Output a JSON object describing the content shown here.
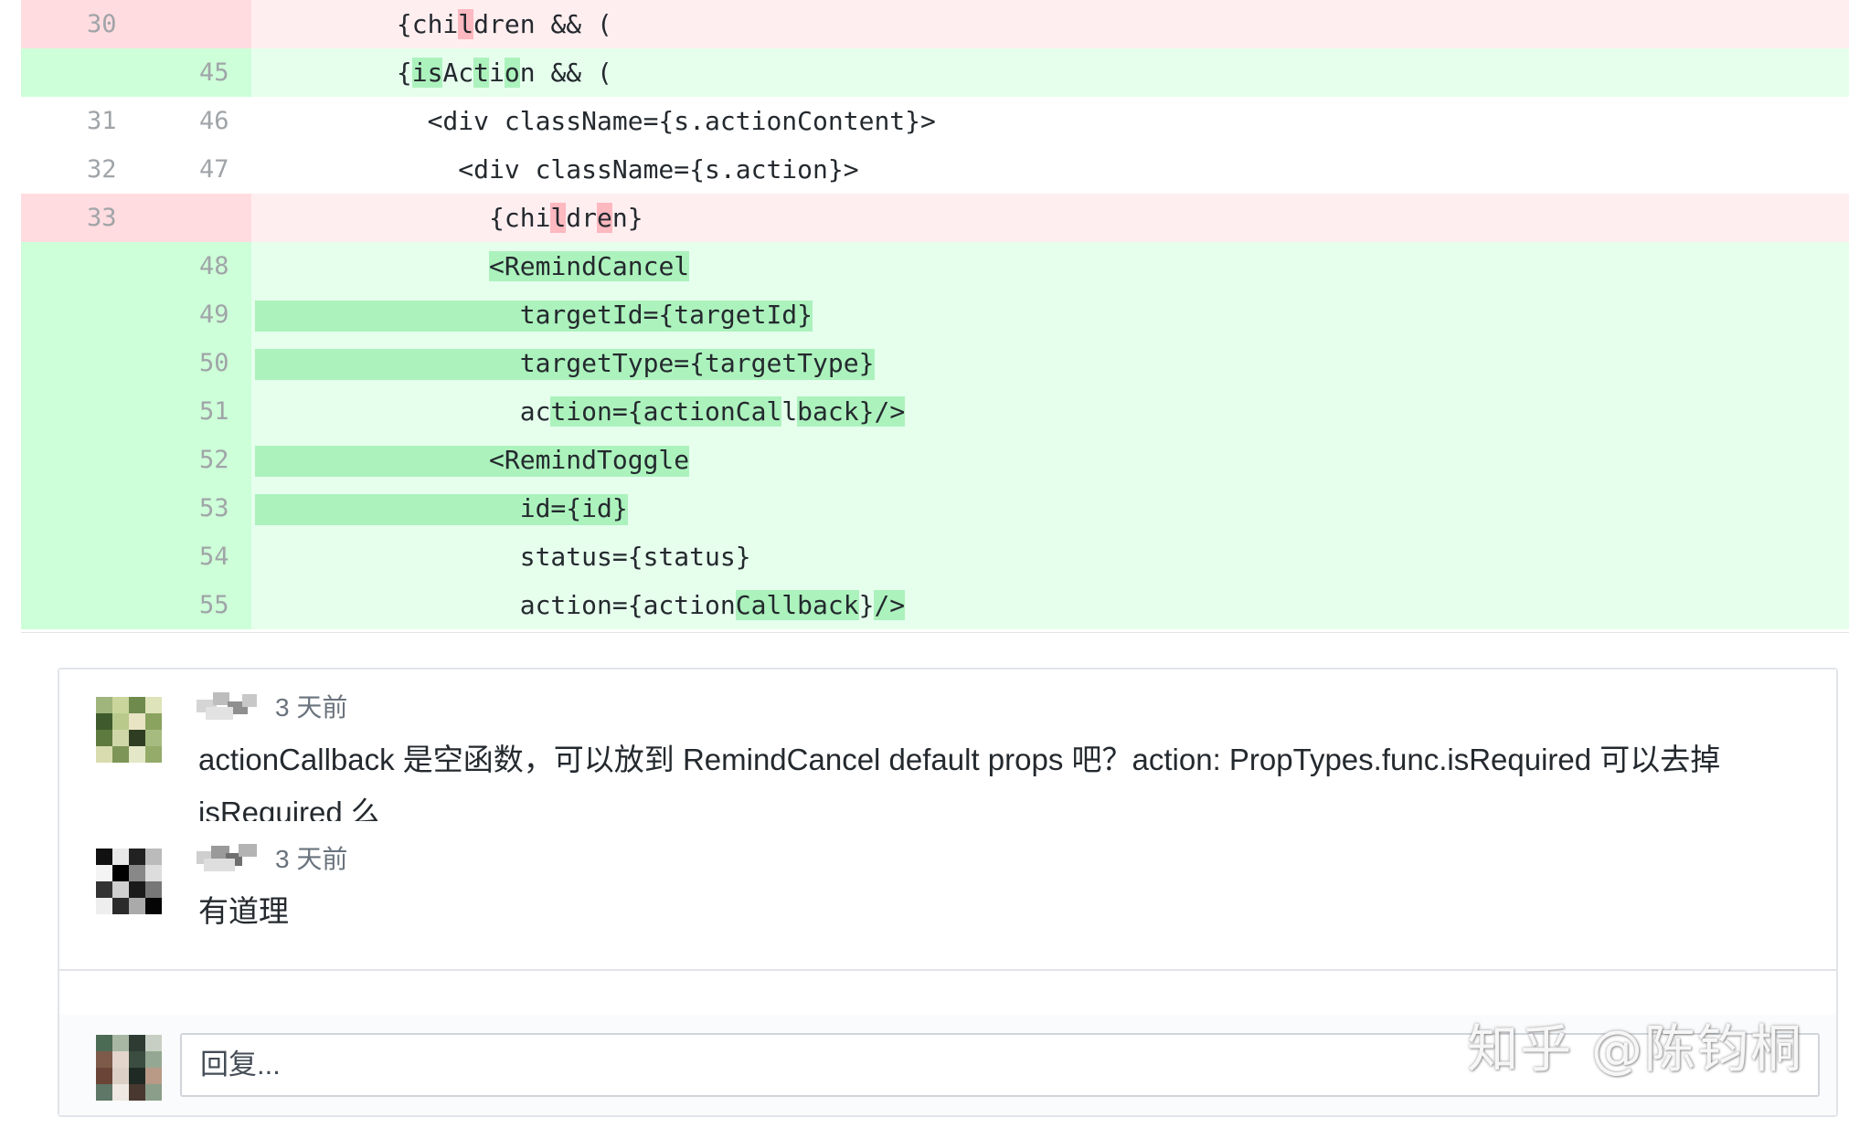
{
  "diff": {
    "lines": [
      {
        "type": "del",
        "old": "30",
        "new": "",
        "segs": [
          {
            "t": "        {chi"
          },
          {
            "t": "l",
            "h": 1
          },
          {
            "t": "dren && ("
          }
        ]
      },
      {
        "type": "add",
        "old": "",
        "new": "45",
        "segs": [
          {
            "t": "        {"
          },
          {
            "t": "is",
            "h": 1
          },
          {
            "t": "Ac"
          },
          {
            "t": "t",
            "h": 1
          },
          {
            "t": "i"
          },
          {
            "t": "o",
            "h": 1
          },
          {
            "t": "n && ("
          }
        ]
      },
      {
        "type": "ctx",
        "old": "31",
        "new": "46",
        "segs": [
          {
            "t": "          <div className={s.actionContent}>"
          }
        ]
      },
      {
        "type": "ctx",
        "old": "32",
        "new": "47",
        "segs": [
          {
            "t": "            <div className={s.action}>"
          }
        ]
      },
      {
        "type": "del",
        "old": "33",
        "new": "",
        "segs": [
          {
            "t": "              {chi"
          },
          {
            "t": "l",
            "h": 1
          },
          {
            "t": "dr"
          },
          {
            "t": "e",
            "h": 1
          },
          {
            "t": "n}"
          }
        ]
      },
      {
        "type": "add",
        "old": "",
        "new": "48",
        "segs": [
          {
            "t": "              "
          },
          {
            "t": "<RemindCancel",
            "h": 1
          }
        ]
      },
      {
        "type": "add",
        "old": "",
        "new": "49",
        "segs": [
          {
            "t": "                targetId={targetId}"
          }
        ]
      },
      {
        "type": "add",
        "old": "",
        "new": "50",
        "segs": [
          {
            "t": "                targetType={targetType}"
          }
        ]
      },
      {
        "type": "add",
        "old": "",
        "new": "51",
        "segs": [
          {
            "t": "                ac"
          },
          {
            "t": "tion={actionCal",
            "h": 1
          },
          {
            "t": "l"
          },
          {
            "t": "back}",
            "h": 1
          },
          {
            "t": "/>",
            "h": 1
          }
        ]
      },
      {
        "type": "add",
        "old": "",
        "new": "52",
        "segs": [
          {
            "t": "              <RemindToggle"
          }
        ]
      },
      {
        "type": "add",
        "old": "",
        "new": "53",
        "segs": [
          {
            "t": "                id={id}"
          }
        ]
      },
      {
        "type": "add",
        "old": "",
        "new": "54",
        "segs": [
          {
            "t": "                status={status}"
          }
        ]
      },
      {
        "type": "add",
        "old": "",
        "new": "55",
        "segs": [
          {
            "t": "                action={action"
          },
          {
            "t": "Callback",
            "h": 1
          },
          {
            "t": "}"
          },
          {
            "t": "/>",
            "h": 1
          }
        ]
      }
    ]
  },
  "comments": [
    {
      "time": "3 天前",
      "body": "actionCallback 是空函数，可以放到 RemindCancel default props 吧？action: PropTypes.func.isRequired 可以去掉 isRequired 么"
    },
    {
      "time": "3 天前",
      "body": "有道理"
    }
  ],
  "reply": {
    "placeholder": "回复..."
  },
  "watermark": "知乎 @陈钧桐",
  "colors": {
    "del_bg": "#ffeef0",
    "del_gutter": "#ffdce0",
    "add_bg": "#e6ffed",
    "add_gutter": "#cdffd8",
    "add_word": "#acf2bd",
    "del_word": "#fdb8c0"
  },
  "icons": [
    "avatar-1",
    "avatar-2",
    "avatar-3"
  ]
}
